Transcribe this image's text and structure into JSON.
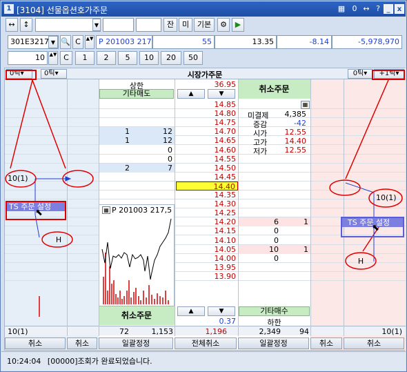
{
  "window": {
    "title": "[3104] 선물옵션호가주문",
    "title_icon": "1"
  },
  "toolbar": {
    "arrow_h": "↔",
    "arrow_v": "↕",
    "field1": "",
    "field2": "",
    "field3": "",
    "btn_jan": "잔",
    "btn_mi": "미",
    "btn_basic": "기본"
  },
  "row2": {
    "code": "301E3217",
    "c_btn": "C",
    "name": "P 201003 217",
    "v1": "55",
    "v2": "13.35",
    "v3": "-8.14",
    "v4": "-5,978,970"
  },
  "row3": {
    "qty": "10",
    "c_btn": "C",
    "q1": "1",
    "q2": "2",
    "q3": "5",
    "q4": "10",
    "q5": "20",
    "q6": "50"
  },
  "header": {
    "left_tick1": "0틱",
    "left_tick2": "0틱",
    "center_title": "시장가주문",
    "right_tick1": "0틱",
    "right_tick2": "+1틱"
  },
  "top_rows": {
    "upper_limit_label": "상한",
    "upper_limit_value": "36.95",
    "other_sell": "기타매도",
    "up_arrow": "▲",
    "down_arrow": "▼",
    "cancel_order": "취소주문"
  },
  "prices": [
    "14.85",
    "14.80",
    "14.75",
    "14.70",
    "14.65",
    "14.60",
    "14.55",
    "14.50",
    "14.45",
    "14.40",
    "14.35",
    "14.30",
    "14.25",
    "14.20",
    "14.15",
    "14.10",
    "14.05",
    "14.00",
    "13.95",
    "13.90"
  ],
  "sell_counts": [
    "",
    "",
    "",
    "1",
    "1",
    "",
    "",
    "2",
    "",
    ""
  ],
  "sell_qtys": [
    "",
    "",
    "",
    "12",
    "12",
    "0",
    "0",
    "7",
    "",
    ""
  ],
  "buy_qtys": [
    "",
    "",
    "",
    "6",
    "0",
    "0",
    "10",
    "0",
    "",
    ""
  ],
  "buy_counts": [
    "",
    "",
    "",
    "1",
    "",
    "",
    "1",
    "",
    "",
    ""
  ],
  "info": {
    "open_interest_label": "미결제",
    "open_interest": "4,385",
    "change_label": "증감",
    "change": "-42",
    "open_label": "시가",
    "open": "12.55",
    "high_label": "고가",
    "high": "14.40",
    "low_label": "저가",
    "low": "12.55"
  },
  "mini_chart": {
    "label": "P 201003 217,5"
  },
  "bottom_rows": {
    "cancel_order": "취소주문",
    "other_buy": "기타매수",
    "lower_limit_label": "하한",
    "change_value": "0.37"
  },
  "totals": {
    "left_pos": "10(1)",
    "sell_count": "72",
    "sell_qty": "1,153",
    "center": "1,196",
    "buy_qty": "2,349",
    "buy_count": "94",
    "right_pos": "10(1)"
  },
  "bottom_buttons": {
    "cancel1": "취소",
    "cancel2": "취소",
    "bulk_fix1": "일괄정정",
    "cancel_all": "전체취소",
    "bulk_fix2": "일괄정정",
    "cancel3": "취소",
    "cancel4": "취소"
  },
  "annotations": {
    "left_pos": "10(1)",
    "right_pos": "10(1)",
    "ts_button": "TS 주문 설정",
    "h_label": "H"
  },
  "status": {
    "time": "10:24:04",
    "message": "[00000]조회가 완료되었습니다."
  },
  "colors": {
    "ask_bg": "#dbe8f7",
    "bid_bg": "#fde3e3",
    "accent_green": "#c7ecc4",
    "highlight_yellow": "#ffff33",
    "price_red": "#c00000",
    "callout_red": "#e00000"
  }
}
